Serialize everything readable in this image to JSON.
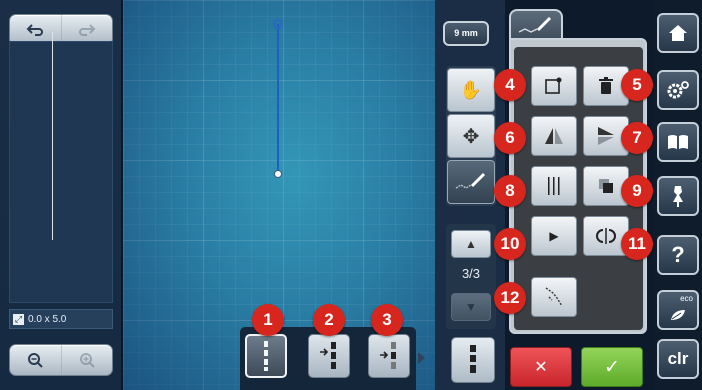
{
  "left_panel": {
    "size_readout": "0.0 x 5.0",
    "size_icon": "resize-icon",
    "top_buttons": [
      "undo-icon",
      "redo-icon"
    ],
    "bottom_buttons": [
      "zoom-out-icon",
      "zoom-in-icon"
    ]
  },
  "stitch_width": {
    "label": "9 mm"
  },
  "pattern_page": {
    "label": "3/3"
  },
  "badges": {
    "b1": "1",
    "b2": "2",
    "b3": "3",
    "b4": "4",
    "b5": "5",
    "b6": "6",
    "b7": "7",
    "b8": "8",
    "b9": "9",
    "b10": "10",
    "b11": "11",
    "b12": "12"
  },
  "sidebar": {
    "eco_label": "eco",
    "help_label": "?",
    "clr_label": "clr"
  },
  "icons": {
    "cancel": "✕",
    "confirm": "✓"
  },
  "colors": {
    "badge": "#d7261e",
    "cancel": "#d9343a",
    "confirm": "#6fbd34",
    "stitch_line": "#1f5fc0"
  }
}
